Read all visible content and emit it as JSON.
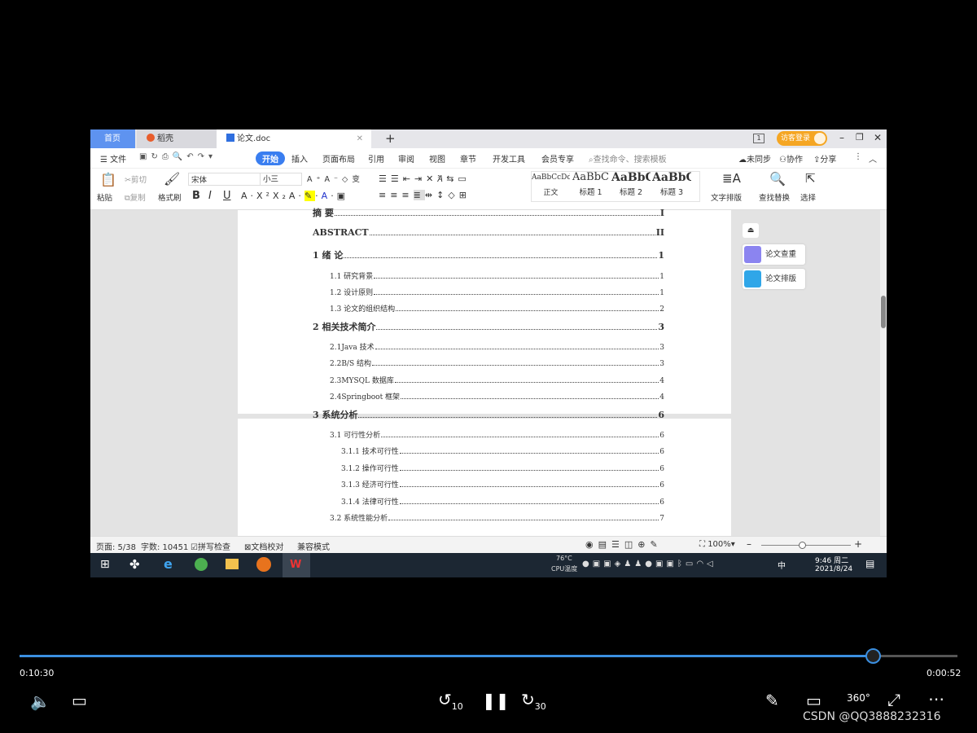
{
  "tabs": {
    "home": "首页",
    "daoke": "稻壳",
    "doc": "论文.doc",
    "new_tab": "+"
  },
  "window": {
    "login": "访客登录",
    "badge": "1"
  },
  "menu": {
    "file": "文件",
    "items": [
      "开始",
      "插入",
      "页面布局",
      "引用",
      "审阅",
      "视图",
      "章节",
      "开发工具",
      "会员专享"
    ],
    "search_placeholder": "查找命令、搜索模板",
    "sync": "未同步",
    "collab": "协作",
    "share": "分享"
  },
  "ribbon": {
    "paste": "粘贴",
    "cut": "剪切",
    "copy": "复制",
    "format_painter": "格式刷",
    "font": "宋体",
    "size": "小三",
    "styles": [
      {
        "preview": "AaBbCcDd",
        "label": "正文"
      },
      {
        "preview": "AaBbC",
        "label": "标题 1"
      },
      {
        "preview": "AaBbC",
        "label": "标题 2"
      },
      {
        "preview": "AaBbC",
        "label": "标题 3"
      }
    ],
    "text_layout": "文字排版",
    "find_replace": "查找替换",
    "select": "选择",
    "bold": "B",
    "italic": "I",
    "underline": "U"
  },
  "toc": [
    {
      "text": "摘 要",
      "page": "I",
      "level": 0
    },
    {
      "text": "ABSTRACT",
      "page": "II",
      "level": 0
    },
    {
      "text": "1 绪 论",
      "page": "1",
      "level": 0
    },
    {
      "text": "1.1 研究背景",
      "page": "1",
      "level": 1
    },
    {
      "text": "1.2 设计原则",
      "page": "1",
      "level": 1
    },
    {
      "text": "1.3 论文的组织结构",
      "page": "2",
      "level": 1
    },
    {
      "text": "2 相关技术简介",
      "page": "3",
      "level": 0
    },
    {
      "text": "2.1Java 技术",
      "page": "3",
      "level": 1
    },
    {
      "text": "2.2B/S 结构",
      "page": "3",
      "level": 1
    },
    {
      "text": "2.3MYSQL 数据库",
      "page": "4",
      "level": 1
    },
    {
      "text": "2.4Springboot 框架",
      "page": "4",
      "level": 1
    },
    {
      "text": "3 系统分析",
      "page": "6",
      "level": 0
    },
    {
      "text": "3.1 可行性分析",
      "page": "6",
      "level": 1
    },
    {
      "text": "3.1.1 技术可行性",
      "page": "6",
      "level": 2
    },
    {
      "text": "3.1.2 操作可行性",
      "page": "6",
      "level": 2
    },
    {
      "text": "3.1.3 经济可行性",
      "page": "6",
      "level": 2
    },
    {
      "text": "3.1.4 法律可行性",
      "page": "6",
      "level": 2
    },
    {
      "text": "3.2 系统性能分析",
      "page": "7",
      "level": 1
    }
  ],
  "side_panel": {
    "check": "论文查重",
    "format": "论文排版"
  },
  "status": {
    "page": "页面: 5/38",
    "words": "字数: 10451",
    "spell": "拼写检查",
    "proof": "文档校对",
    "compat": "兼容模式",
    "zoom": "100%"
  },
  "taskbar": {
    "time": "9:46 周二",
    "date": "2021/8/24",
    "temp": "76°C",
    "cpu": "CPU温度",
    "ime": "中"
  },
  "player": {
    "elapsed": "0:10:30",
    "remaining": "0:00:52",
    "progress": 0.9094,
    "skip_back": "10",
    "skip_fwd": "30",
    "vr": "360°",
    "watermark": "CSDN @QQ3888232316",
    "accent": "#3b8fe0"
  }
}
